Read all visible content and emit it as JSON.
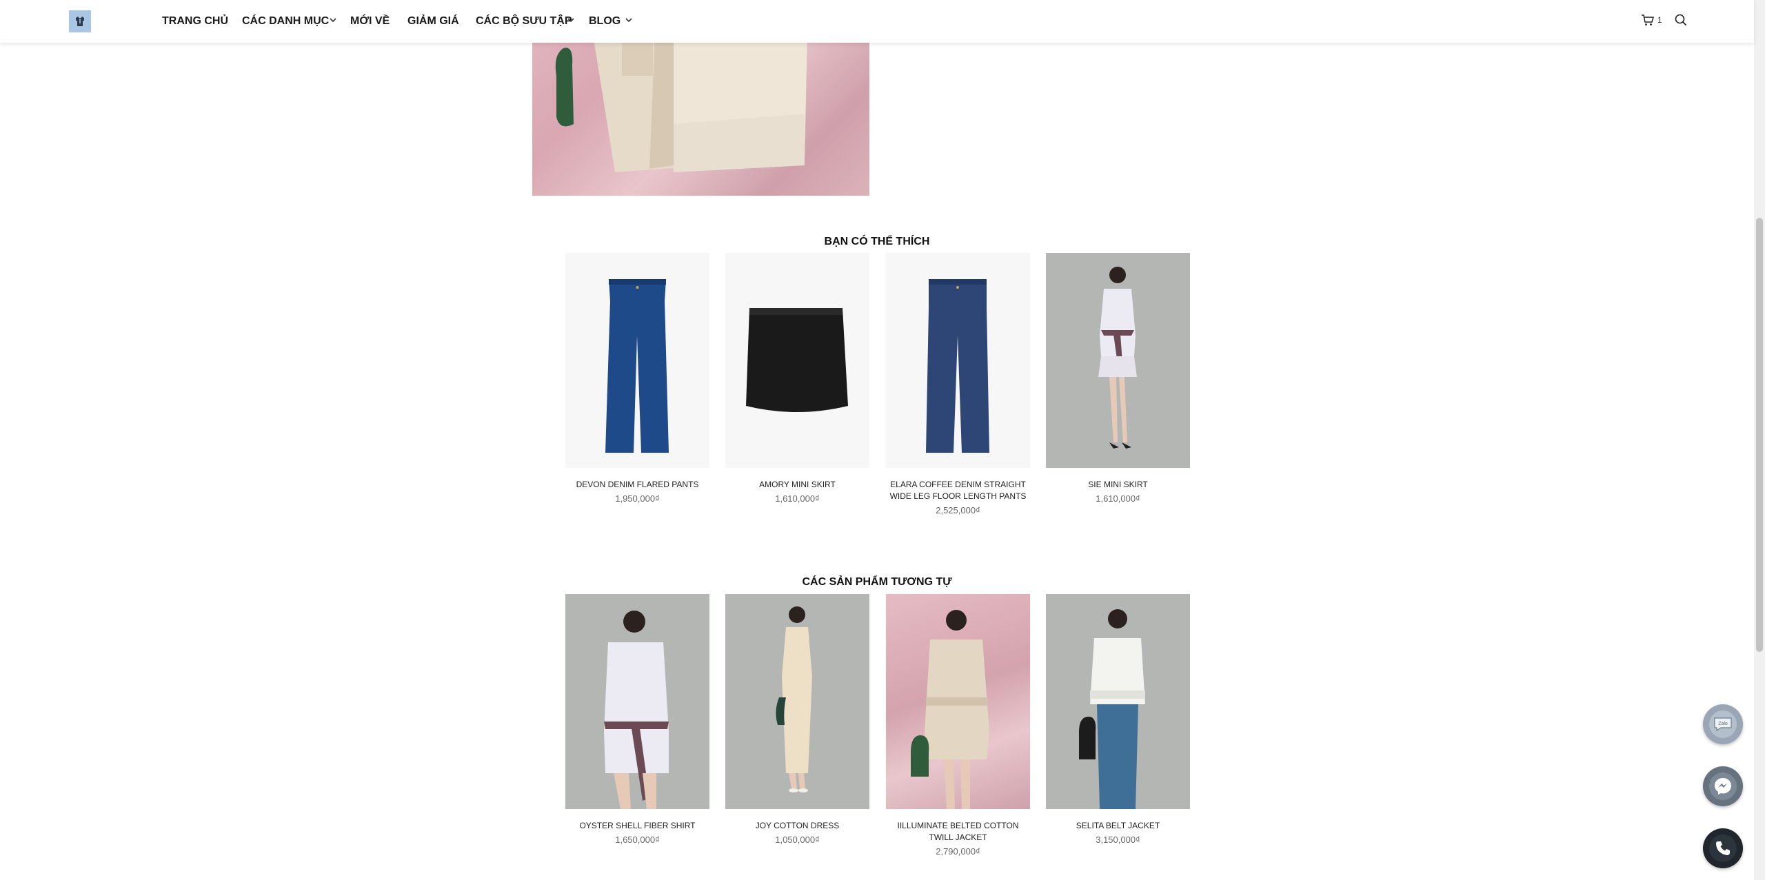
{
  "header": {
    "nav": [
      {
        "label": "TRANG CHỦ",
        "has_dropdown": false
      },
      {
        "label": "CÁC DANH MỤC",
        "has_dropdown": true
      },
      {
        "label": "MỚI VỀ",
        "has_dropdown": false
      },
      {
        "label": "GIẢM GIÁ",
        "has_dropdown": false
      },
      {
        "label": "CÁC BỘ SƯU TẬP",
        "has_dropdown": true
      },
      {
        "label": "BLOG",
        "has_dropdown": true
      }
    ],
    "cart_count": "1",
    "icons": [
      "shirt-logo-icon",
      "chevron-down-icon",
      "cart-icon",
      "search-icon"
    ]
  },
  "recommended": {
    "title": "BẠN CÓ THỂ THÍCH",
    "products": [
      {
        "name": "DEVON DENIM FLARED PANTS",
        "price": "1,950,000₫"
      },
      {
        "name": "AMORY MINI SKIRT",
        "price": "1,610,000₫"
      },
      {
        "name": "ELARA COFFEE DENIM STRAIGHT WIDE LEG FLOOR LENGTH PANTS",
        "price": "2,525,000₫"
      },
      {
        "name": "SIE MINI SKIRT",
        "price": "1,610,000₫"
      }
    ]
  },
  "similar": {
    "title": "CÁC SẢN PHẨM TƯƠNG TỰ",
    "products": [
      {
        "name": "OYSTER SHELL FIBER SHIRT",
        "price": "1,650,000₫"
      },
      {
        "name": "JOY COTTON DRESS",
        "price": "1,050,000₫"
      },
      {
        "name": "IILLUMINATE BELTED COTTON TWILL JACKET",
        "price": "2,790,000₫"
      },
      {
        "name": "SELITA BELT JACKET",
        "price": "3,150,000₫"
      }
    ]
  },
  "floating": {
    "zalo_label": "Zalo",
    "icons": [
      "zalo-chat-icon",
      "messenger-icon",
      "phone-icon"
    ]
  },
  "colors": {
    "denim": "#1f4a8a",
    "skirt_black": "#1a1a1a",
    "photo_grey": "#b4b6b4",
    "photo_pink": "#dcb0b8",
    "phone_button": "#20262c"
  }
}
